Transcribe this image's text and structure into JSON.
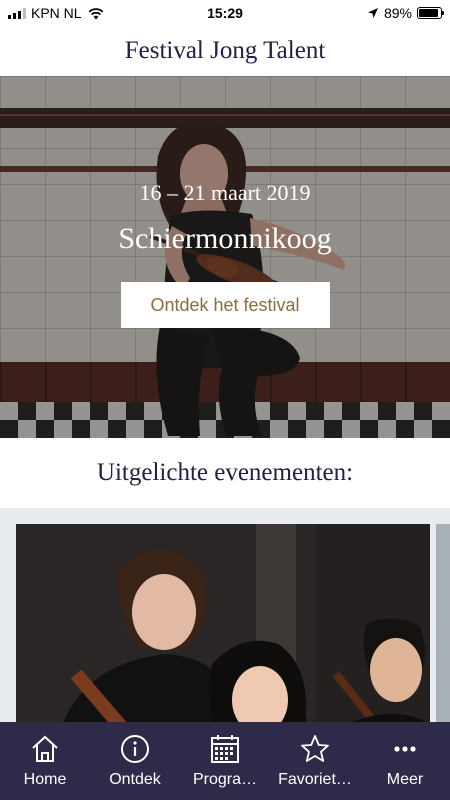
{
  "status_bar": {
    "carrier": "KPN NL",
    "time": "15:29",
    "battery": "89%",
    "battery_level": 0.89
  },
  "header": {
    "title": "Festival Jong Talent"
  },
  "hero": {
    "dates": "16 – 21 maart 2019",
    "place": "Schiermonnikoog",
    "button_label": "Ontdek het festival"
  },
  "featured": {
    "title": "Uitgelichte evenementen:"
  },
  "tabs": [
    {
      "label": "Home",
      "icon": "home-icon"
    },
    {
      "label": "Ontdek",
      "icon": "info-icon"
    },
    {
      "label": "Progra…",
      "icon": "calendar-icon"
    },
    {
      "label": "Favoriet…",
      "icon": "star-icon"
    },
    {
      "label": "Meer",
      "icon": "more-icon"
    }
  ],
  "colors": {
    "brand_navy": "#232044",
    "tab_bar": "#2e2b4a",
    "button_text": "#8a6d3b"
  }
}
